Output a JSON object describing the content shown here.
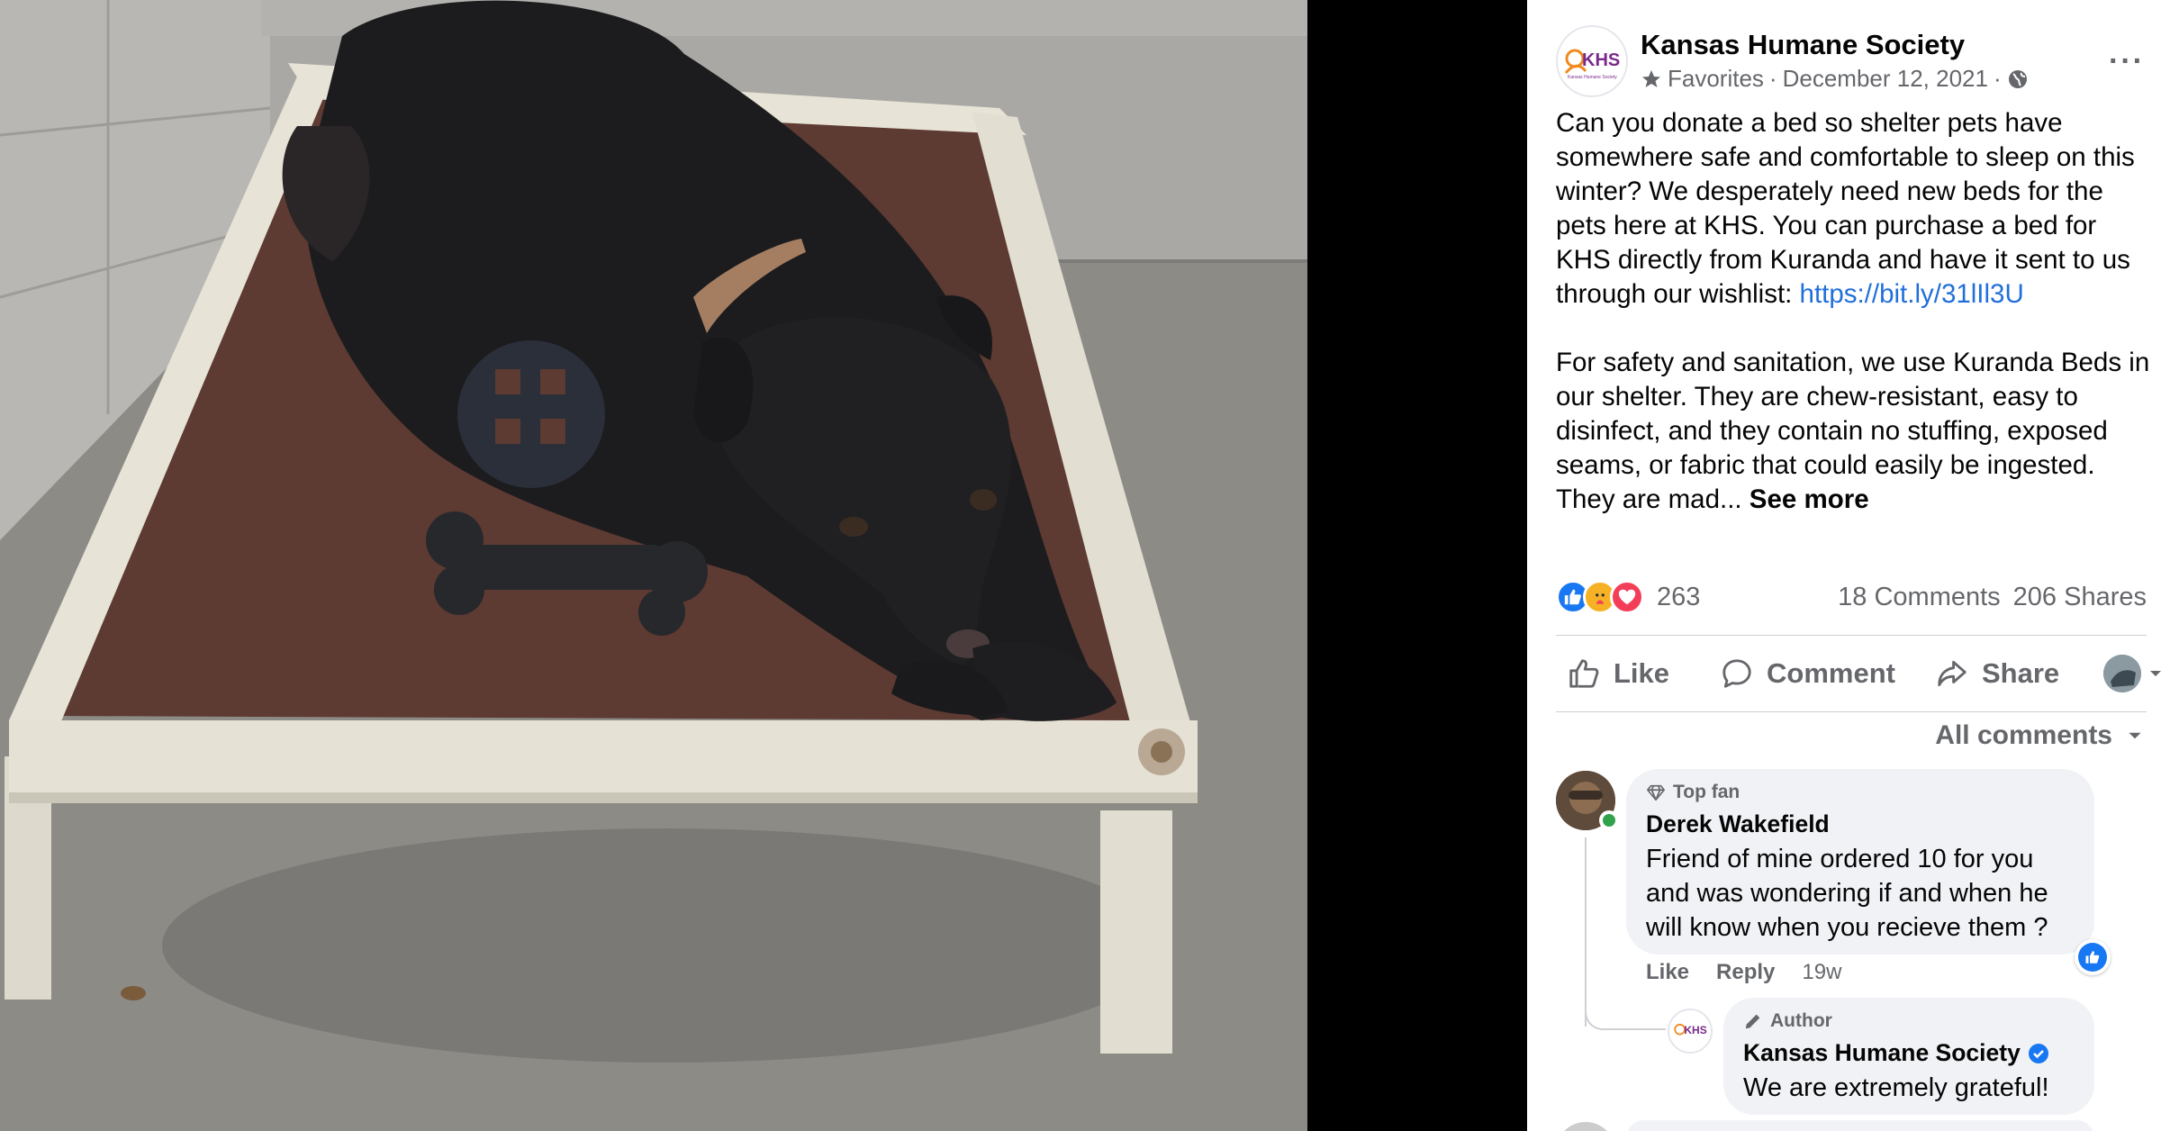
{
  "post": {
    "page_name": "Kansas Humane Society",
    "page_logo_text": "KHS",
    "audience": "Favorites",
    "date": "December 12, 2021",
    "separator": "·",
    "more_label": "···",
    "paragraph1": "Can you donate a bed so shelter pets have somewhere safe and comfortable to sleep on this winter? We desperately need new beds for the pets here at KHS. You can purchase a bed for KHS directly from Kuranda and have it sent to us through our wishlist: ",
    "link": "https://bit.ly/31lIl3U",
    "paragraph2": "For safety and sanitation, we use Kuranda Beds in our shelter. They are chew-resistant, easy to disinfect, and they contain no stuffing, exposed seams, or fabric that could easily be ingested. They are mad...",
    "see_more": "See more"
  },
  "stats": {
    "reaction_count": "263",
    "comments": "18 Comments",
    "shares": "206 Shares"
  },
  "actions": {
    "like": "Like",
    "comment": "Comment",
    "share": "Share"
  },
  "comments": {
    "sort_label": "All comments",
    "c1": {
      "badge": "Top fan",
      "name": "Derek Wakefield",
      "text": "Friend of mine ordered 10 for you and was wondering if and when he will know when you recieve them ?",
      "like": "Like",
      "reply": "Reply",
      "time": "19w"
    },
    "c2": {
      "badge": "Author",
      "name": "Kansas Humane Society",
      "text": "We are extremely grateful!"
    }
  },
  "colors": {
    "link": "#216fdb",
    "secondary_text": "#65676b",
    "bubble": "#f0f2f5",
    "like_blue": "#1877f2",
    "love_red": "#f33e58",
    "care_yellow": "#f7b125"
  },
  "icons": [
    "star-icon",
    "globe-icon",
    "more-icon",
    "like-reaction-icon",
    "care-reaction-icon",
    "love-reaction-icon",
    "thumbs-up-icon",
    "comment-icon",
    "share-icon",
    "chevron-down-icon",
    "diamond-icon",
    "pencil-icon",
    "verified-icon"
  ]
}
